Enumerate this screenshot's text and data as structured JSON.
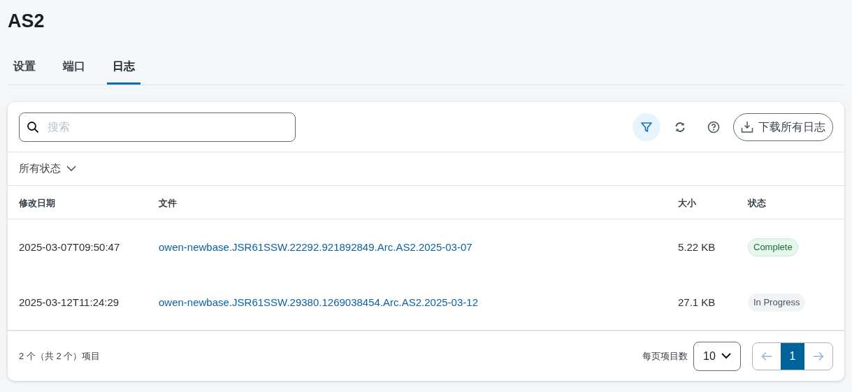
{
  "title": "AS2",
  "tabs": [
    {
      "label": "设置",
      "selected": false
    },
    {
      "label": "端口",
      "selected": false
    },
    {
      "label": "日志",
      "selected": true
    }
  ],
  "search": {
    "placeholder": "搜索"
  },
  "toolbar": {
    "filter_active": true,
    "download_label": "下载所有日志"
  },
  "status_filter": "所有状态",
  "table": {
    "columns": [
      "修改日期",
      "文件",
      "大小",
      "状态"
    ],
    "rows": [
      {
        "date": "2025-03-07T09:50:47",
        "file": "owen-newbase.JSR61SSW.22292.921892849.Arc.AS2.2025-03-07",
        "size": "5.22 KB",
        "status": {
          "label": "Complete",
          "kind": "complete"
        }
      },
      {
        "date": "2025-03-12T11:24:29",
        "file": "owen-newbase.JSR61SSW.29380.1269038454.Arc.AS2.2025-03-12",
        "size": "27.1 KB",
        "status": {
          "label": "In Progress",
          "kind": "in_progress"
        }
      }
    ]
  },
  "footer": {
    "summary": "2 个（共 2 个）项目",
    "per_page_label": "每页项目数",
    "per_page": "10",
    "pages": [
      {
        "label": "1",
        "selected": true
      }
    ]
  }
}
